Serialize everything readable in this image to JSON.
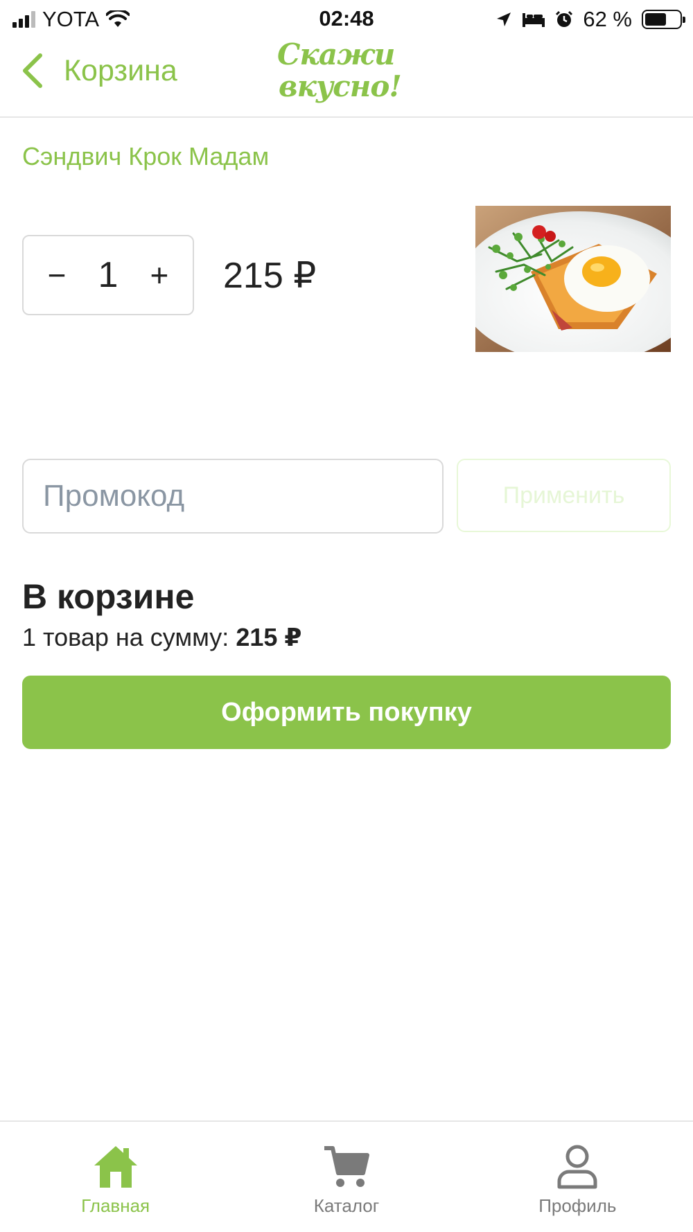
{
  "status_bar": {
    "carrier": "YOTA",
    "time": "02:48",
    "battery": "62 %"
  },
  "nav": {
    "back_label": "Корзина",
    "logo_line1": "Скажи",
    "logo_line2": "вкусно!"
  },
  "product": {
    "title": "Сэндвич Крок Мадам",
    "quantity": "1",
    "minus": "−",
    "plus": "+",
    "price": "215 ₽",
    "image_icon": "croque-madame-photo"
  },
  "promo": {
    "placeholder": "Промокод",
    "apply_label": "Применить"
  },
  "summary": {
    "heading": "В корзине",
    "text": "1 товар на сумму:",
    "total": "215 ₽",
    "checkout_label": "Оформить покупку"
  },
  "tabs": [
    {
      "label": "Главная",
      "icon": "home-icon",
      "active": true
    },
    {
      "label": "Каталог",
      "icon": "cart-icon",
      "active": false
    },
    {
      "label": "Профиль",
      "icon": "profile-icon",
      "active": false
    }
  ],
  "colors": {
    "accent": "#8bc34a",
    "tab_inactive": "#7a7a7a",
    "placeholder": "#8a96a3"
  }
}
